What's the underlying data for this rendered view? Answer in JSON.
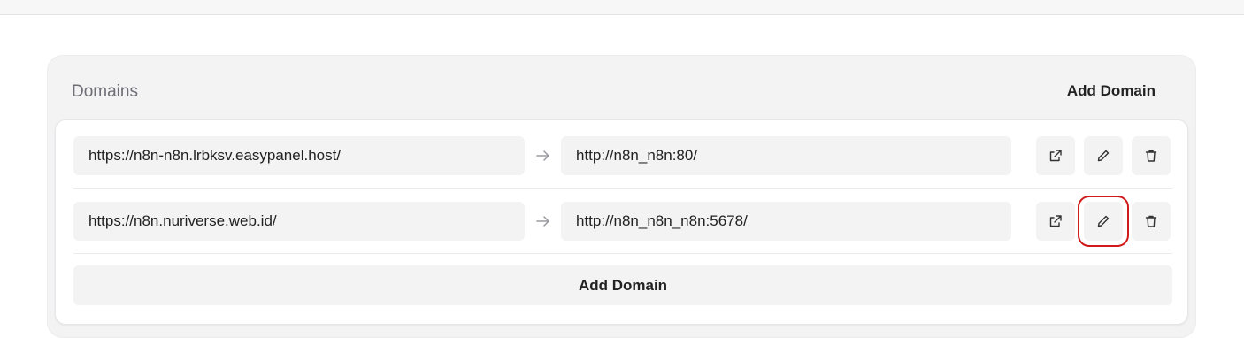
{
  "section": {
    "title": "Domains",
    "add_label": "Add Domain"
  },
  "domains": [
    {
      "source": "https://n8n-n8n.lrbksv.easypanel.host/",
      "target": "http://n8n_n8n:80/"
    },
    {
      "source": "https://n8n.nuriverse.web.id/",
      "target": "http://n8n_n8n_n8n:5678/"
    }
  ],
  "footer": {
    "add_label": "Add Domain"
  },
  "icons": {
    "arrow": "arrow-right-icon",
    "open": "external-link-icon",
    "edit": "pencil-icon",
    "delete": "trash-icon"
  },
  "colors": {
    "highlight": "#d11a1a",
    "card_bg": "#f3f3f4",
    "field_bg": "#f3f3f4"
  }
}
